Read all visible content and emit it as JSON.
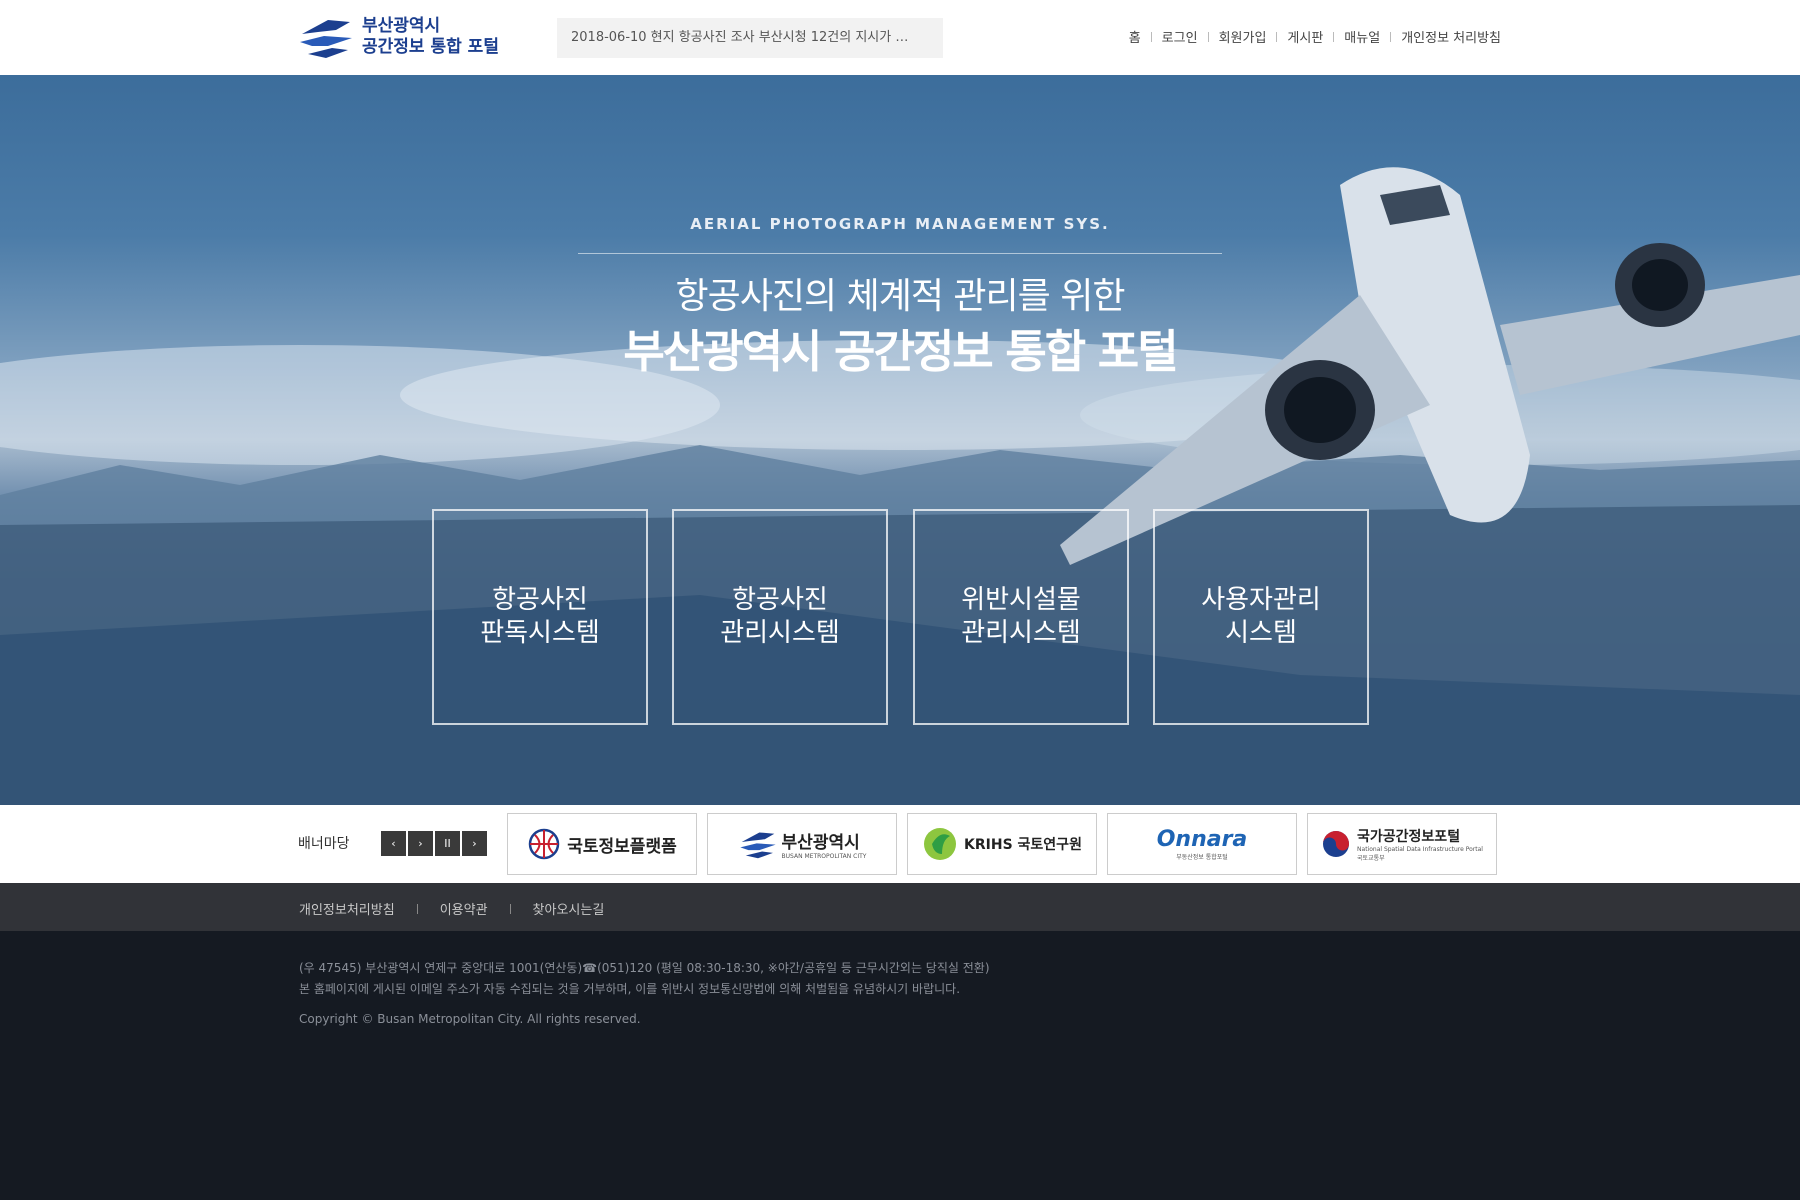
{
  "header": {
    "logo_line1": "부산광역시",
    "logo_line2": "공간정보 통합 포털",
    "notice": "2018-06-10 현지 항공사진 조사 부산시청 12건의 지시가 …",
    "nav": [
      "홈",
      "로그인",
      "회원가입",
      "게시판",
      "매뉴얼",
      "개인정보 처리방침"
    ]
  },
  "hero": {
    "subtitle": "AERIAL PHOTOGRAPH  MANAGEMENT SYS.",
    "title_line1": "항공사진의 체계적 관리를 위한",
    "title_line2": "부산광역시 공간정보 통합 포털",
    "systems": [
      {
        "line1": "항공사진",
        "line2": "판독시스템"
      },
      {
        "line1": "항공사진",
        "line2": "관리시스템"
      },
      {
        "line1": "위반시설물",
        "line2": "관리시스템"
      },
      {
        "line1": "사용자관리",
        "line2": "시스템"
      }
    ]
  },
  "banner": {
    "label": "배너마당",
    "controls": [
      "‹",
      "›",
      "II",
      "›"
    ],
    "links": [
      {
        "name": "국토정보플랫폼"
      },
      {
        "name": "부산광역시",
        "sub": "BUSAN METROPOLITAN CITY"
      },
      {
        "name": "KRIHS 국토연구원"
      },
      {
        "name": "Onnara",
        "sub": "부동산정보 통합포털"
      },
      {
        "name": "국가공간정보포털",
        "sub": "국토교통부",
        "sub2": "National Spatial Data Infrastructure Portal"
      }
    ]
  },
  "footer": {
    "nav": [
      "개인정보처리방침",
      "이용약관",
      "찾아오시는길"
    ],
    "address": "(우 47545) 부산광역시 연제구 중앙대로 1001(연산동)☎(051)120 (평일 08:30-18:30, ※야간/공휴일 등 근무시간외는 당직실 전환)",
    "notice": "본 홈페이지에 게시된 이메일 주소가 자동 수집되는 것을 거부하며, 이를 위반시 정보통신망법에 의해 처벌됨을 유념하시기 바랍니다.",
    "copyright": "Copyright © Busan Metropolitan City. All rights reserved."
  },
  "colors": {
    "brand_blue": "#1c3f8f",
    "hero_blue": "#3c6d9b",
    "footer_dark": "#151a22",
    "footer_nav": "#313338"
  }
}
